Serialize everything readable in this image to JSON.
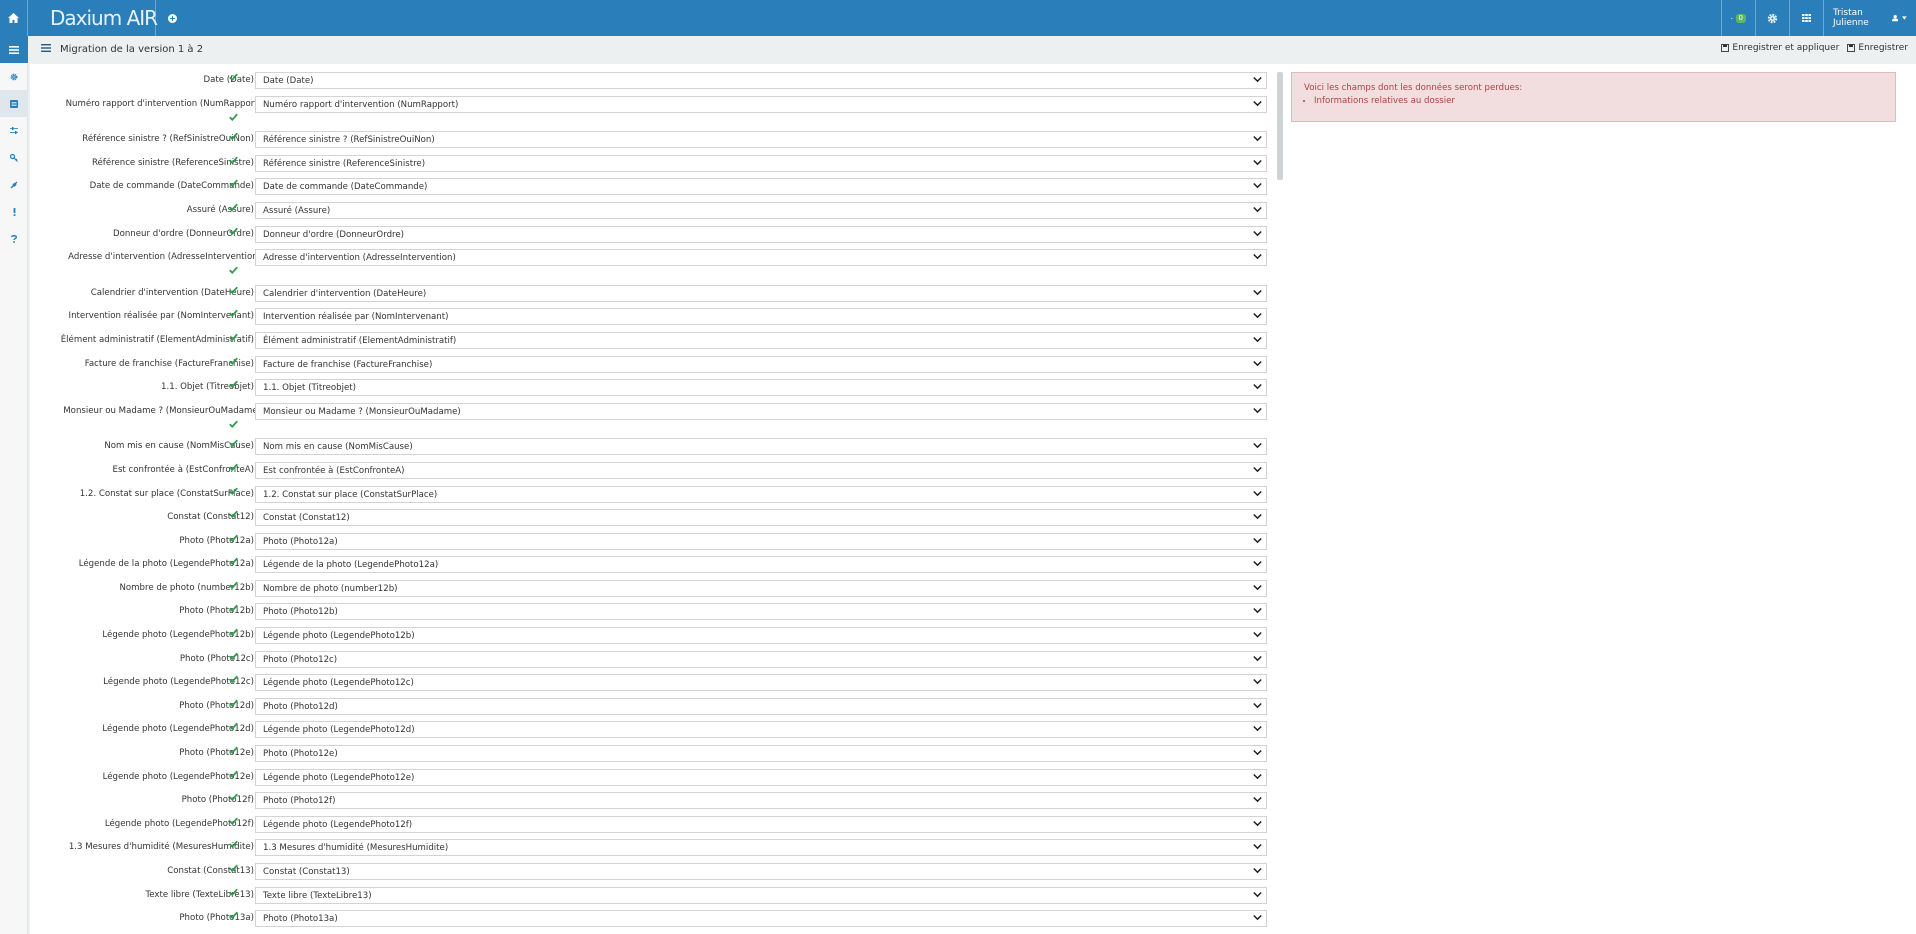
{
  "app": {
    "logo": "Daxium AIR"
  },
  "topbar": {
    "notification_count": "0",
    "user_name": "Tristan Julienne"
  },
  "subheader": {
    "title": "Migration de la version 1 à 2",
    "save_apply_label": "Enregistrer et appliquer",
    "save_label": "Enregistrer"
  },
  "alert": {
    "intro": "Voici les champs dont les données seront perdues:",
    "items": [
      "Informations relatives au dossier"
    ]
  },
  "rows": [
    {
      "label": "Date (Date)",
      "value": "Date (Date)"
    },
    {
      "label": "Numéro rapport d'intervention (NumRapport)",
      "value": "Numéro rapport d'intervention (NumRapport)"
    },
    {
      "label": "Référence sinistre ? (RefSinistreOuiNon)",
      "value": "Référence sinistre ? (RefSinistreOuiNon)"
    },
    {
      "label": "Référence sinistre (ReferenceSinistre)",
      "value": "Référence sinistre (ReferenceSinistre)"
    },
    {
      "label": "Date de commande (DateCommande)",
      "value": "Date de commande (DateCommande)"
    },
    {
      "label": "Assuré (Assure)",
      "value": "Assuré (Assure)"
    },
    {
      "label": "Donneur d'ordre (DonneurOrdre)",
      "value": "Donneur d'ordre (DonneurOrdre)"
    },
    {
      "label": "Adresse d'intervention (AdresseIntervention)",
      "value": "Adresse d'intervention (AdresseIntervention)"
    },
    {
      "label": "Calendrier d'intervention (DateHeure)",
      "value": "Calendrier d'intervention (DateHeure)"
    },
    {
      "label": "Intervention réalisée par (NomIntervenant)",
      "value": "Intervention réalisée par (NomIntervenant)"
    },
    {
      "label": "Élément administratif (ElementAdministratif)",
      "value": "Élément administratif (ElementAdministratif)"
    },
    {
      "label": "Facture de franchise (FactureFranchise)",
      "value": "Facture de franchise (FactureFranchise)"
    },
    {
      "label": "1.1. Objet (Titreobjet)",
      "value": "1.1. Objet (Titreobjet)"
    },
    {
      "label": "Monsieur ou Madame ? (MonsieurOuMadame)",
      "value": "Monsieur ou Madame ? (MonsieurOuMadame)"
    },
    {
      "label": "Nom mis en cause (NomMisCause)",
      "value": "Nom mis en cause (NomMisCause)"
    },
    {
      "label": "Est confrontée à (EstConfronteA)",
      "value": "Est confrontée à (EstConfronteA)"
    },
    {
      "label": "1.2. Constat sur place (ConstatSurPlace)",
      "value": "1.2. Constat sur place (ConstatSurPlace)"
    },
    {
      "label": "Constat (Constat12)",
      "value": "Constat (Constat12)"
    },
    {
      "label": "Photo (Photo12a)",
      "value": "Photo (Photo12a)"
    },
    {
      "label": "Légende de la photo (LegendePhoto12a)",
      "value": "Légende de la photo (LegendePhoto12a)"
    },
    {
      "label": "Nombre de photo (number12b)",
      "value": "Nombre de photo (number12b)"
    },
    {
      "label": "Photo (Photo12b)",
      "value": "Photo (Photo12b)"
    },
    {
      "label": "Légende photo (LegendePhoto12b)",
      "value": "Légende photo (LegendePhoto12b)"
    },
    {
      "label": "Photo (Photo12c)",
      "value": "Photo (Photo12c)"
    },
    {
      "label": "Légende photo (LegendePhoto12c)",
      "value": "Légende photo (LegendePhoto12c)"
    },
    {
      "label": "Photo (Photo12d)",
      "value": "Photo (Photo12d)"
    },
    {
      "label": "Légende photo (LegendePhoto12d)",
      "value": "Légende photo (LegendePhoto12d)"
    },
    {
      "label": "Photo (Photo12e)",
      "value": "Photo (Photo12e)"
    },
    {
      "label": "Légende photo (LegendePhoto12e)",
      "value": "Légende photo (LegendePhoto12e)"
    },
    {
      "label": "Photo (Photo12f)",
      "value": "Photo (Photo12f)"
    },
    {
      "label": "Légende photo (LegendePhoto12f)",
      "value": "Légende photo (LegendePhoto12f)"
    },
    {
      "label": "1.3 Mesures d'humidité (MesuresHumidite)",
      "value": "1.3 Mesures d'humidité (MesuresHumidite)"
    },
    {
      "label": "Constat (Constat13)",
      "value": "Constat (Constat13)"
    },
    {
      "label": "Texte libre (TexteLibre13)",
      "value": "Texte libre (TexteLibre13)"
    },
    {
      "label": "Photo (Photo13a)",
      "value": "Photo (Photo13a)"
    }
  ],
  "colors": {
    "brand": "#2a7fba",
    "check": "#2e9a4c",
    "alert_bg": "#f2dede",
    "alert_text": "#a94442"
  },
  "icons": [
    "home-icon",
    "plus-icon",
    "bell-icon",
    "gear-icon",
    "grid-icon",
    "user-icon",
    "menu-icon",
    "list-icon",
    "check-icon",
    "chevron-down-icon",
    "save-icon"
  ]
}
